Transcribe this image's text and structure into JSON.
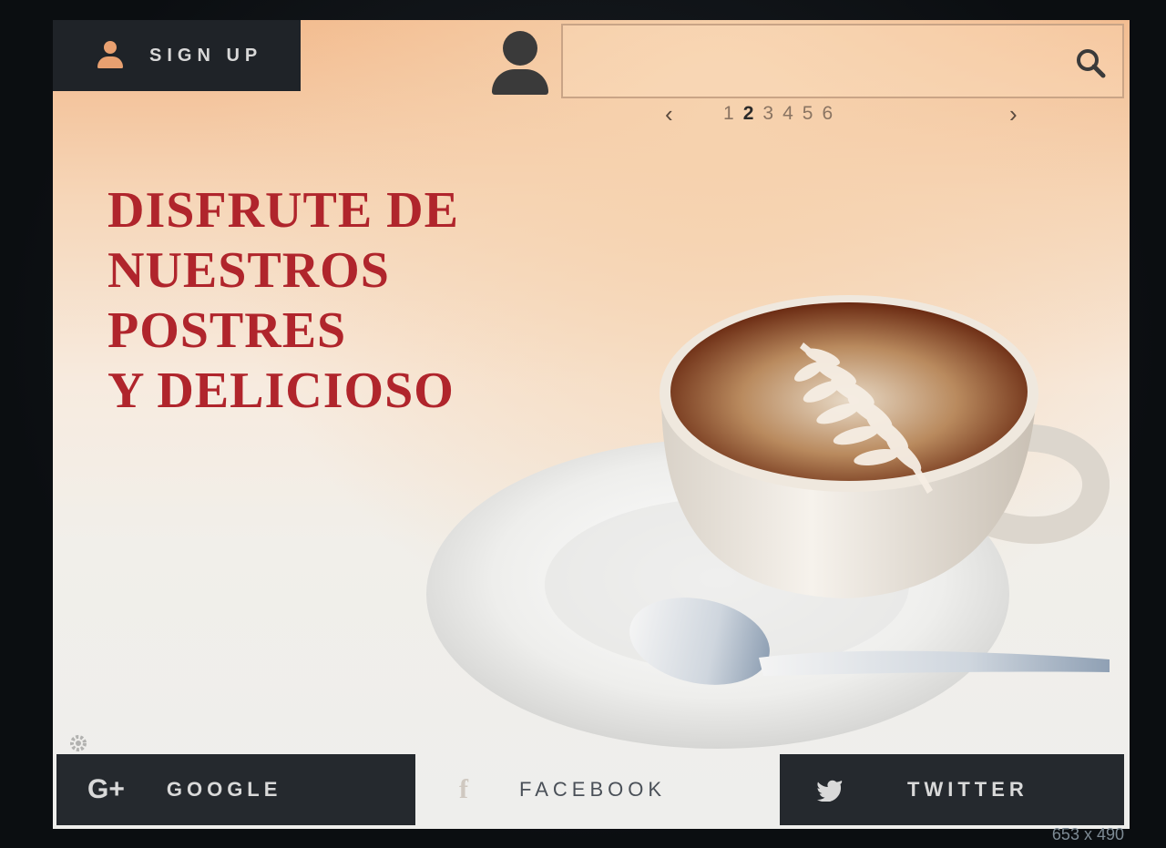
{
  "header": {
    "signup_label": "SIGN UP",
    "search": {
      "placeholder": ""
    }
  },
  "pagination": {
    "prev": "‹",
    "next": "›",
    "pages": [
      "1",
      "2",
      "3",
      "4",
      "5",
      "6"
    ],
    "active": "2"
  },
  "hero": {
    "headline": [
      "DISFRUTE DE",
      "NUESTROS",
      "POSTRES",
      "Y DELICIOSO"
    ]
  },
  "social": {
    "google": {
      "icon": "G+",
      "label": "GOOGLE"
    },
    "facebook": {
      "icon": "f",
      "label": "FACEBOOK"
    },
    "twitter": {
      "icon": "twitter-bird-icon",
      "label": "TWITTER"
    }
  },
  "footer": {
    "dimensions": "653 x 490"
  },
  "colors": {
    "headline": "#b0252c",
    "dark_bar": "#1f2328",
    "accent_icon": "#e8a070"
  }
}
